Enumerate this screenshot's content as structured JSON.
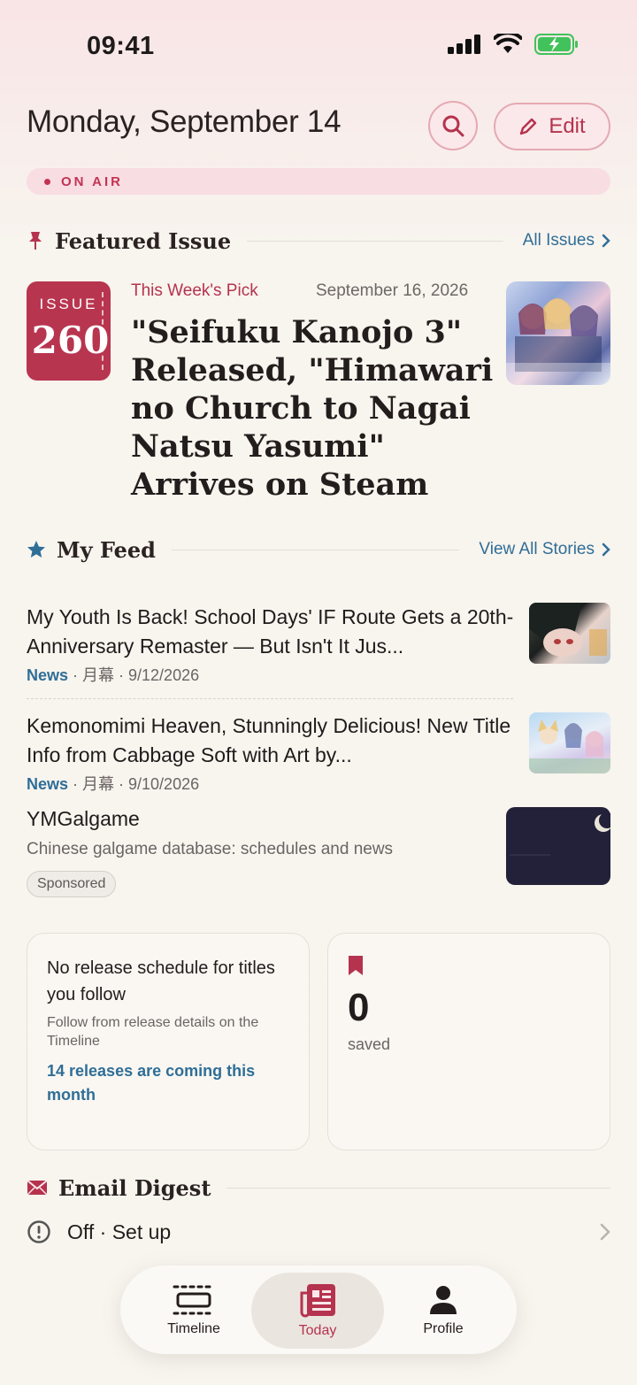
{
  "status_bar": {
    "time": "09:41"
  },
  "header": {
    "date": "Monday, September 14",
    "edit_label": "Edit"
  },
  "on_air": "ON AIR",
  "featured": {
    "section_title": "Featured Issue",
    "more_label": "All Issues",
    "issue_label": "ISSUE",
    "issue_number": "260",
    "kicker": "This Week's Pick",
    "date": "September 16, 2026",
    "headline": "\"Seifuku Kanojo 3\" Released, \"Himawari no Church to Nagai Natsu Yasumi\" Arrives on Steam"
  },
  "feed": {
    "section_title": "My Feed",
    "more_label": "View All Stories",
    "items": [
      {
        "headline": "My Youth Is Back! School Days' IF Route Gets a 20th-Anniversary Remaster — But Isn't It Jus...",
        "category": "News",
        "meta": " · 月幕 · 9/12/2026"
      },
      {
        "headline": "Kemonomimi Heaven, Stunningly Delicious! New Title Info from Cabbage Soft with Art by...",
        "category": "News",
        "meta": " · 月幕 · 9/10/2026"
      }
    ],
    "sponsored": {
      "name": "YMGalgame",
      "description": "Chinese galgame database: schedules and news",
      "tag": "Sponsored"
    }
  },
  "cards": {
    "schedule": {
      "heading": "No release schedule for titles you follow",
      "sub": "Follow from release details on the Timeline",
      "link": "14 releases are coming this month"
    },
    "saved": {
      "count": "0",
      "label": "saved"
    }
  },
  "email": {
    "section_title": "Email Digest",
    "status": "Off · Set up"
  },
  "tabbar": {
    "timeline": "Timeline",
    "today": "Today",
    "profile": "Profile"
  },
  "colors": {
    "accent": "#b5334e",
    "link": "#2f6e97",
    "background": "#f8f5ef"
  }
}
